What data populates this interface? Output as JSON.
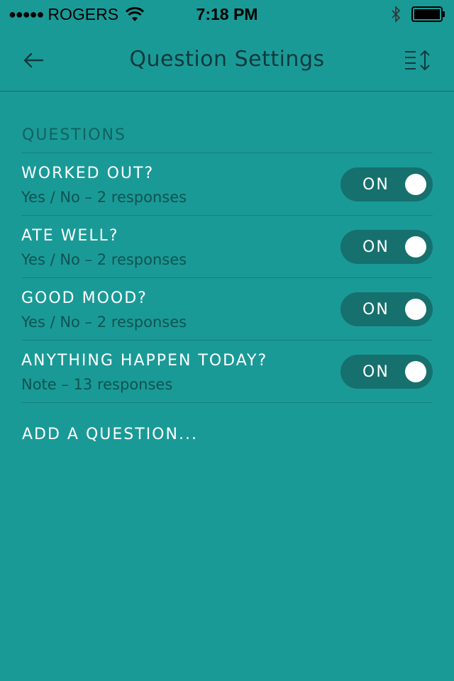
{
  "status_bar": {
    "signal": "●●●●●",
    "carrier": "ROGERS",
    "time": "7:18 PM",
    "wifi_icon": "wifi-icon",
    "bluetooth_icon": "bluetooth-icon",
    "battery_icon": "battery-icon"
  },
  "nav": {
    "title": "Question Settings",
    "back_icon": "arrow-left-icon",
    "reorder_icon": "reorder-icon"
  },
  "section": {
    "header": "QUESTIONS"
  },
  "questions": [
    {
      "title": "WORKED OUT?",
      "subtitle": "Yes / No – 2 responses",
      "toggle": "ON"
    },
    {
      "title": "ATE WELL?",
      "subtitle": "Yes / No – 2 responses",
      "toggle": "ON"
    },
    {
      "title": "GOOD MOOD?",
      "subtitle": "Yes / No – 2 responses",
      "toggle": "ON"
    },
    {
      "title": "ANYTHING HAPPEN TODAY?",
      "subtitle": "Note – 13 responses",
      "toggle": "ON"
    }
  ],
  "add_question": "ADD A QUESTION...",
  "colors": {
    "background": "#1a9a97",
    "toggle_track": "#16706e",
    "title_text": "#103a3d",
    "subtitle_text": "#0f5452"
  }
}
